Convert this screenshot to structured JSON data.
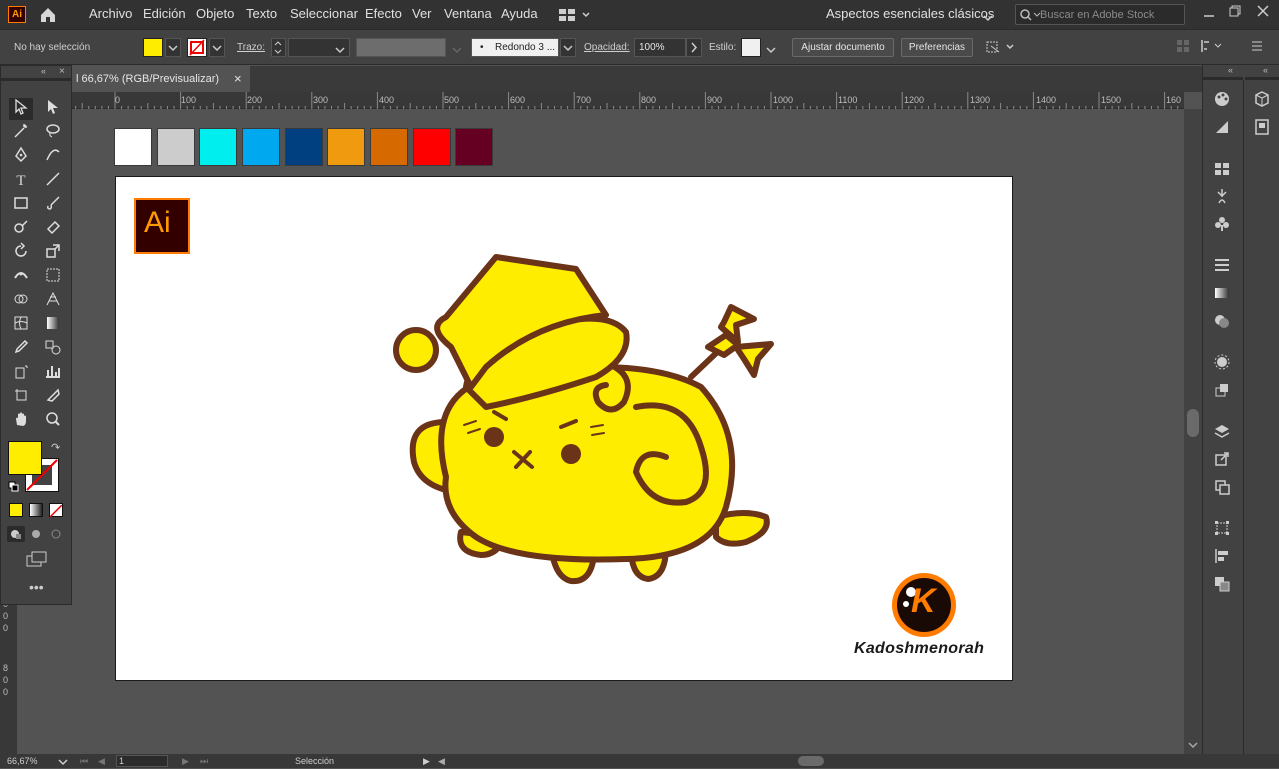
{
  "menubar": {
    "app_logo": "Ai",
    "items": [
      "Archivo",
      "Edición",
      "Objeto",
      "Texto",
      "Seleccionar",
      "Efecto",
      "Ver",
      "Ventana",
      "Ayuda"
    ],
    "workspace": "Aspectos esenciales clásicos",
    "search_placeholder": "Buscar en Adobe Stock"
  },
  "controlbar": {
    "selection": "No hay selección",
    "stroke_label": "Trazo:",
    "brush": "Redondo 3 ...",
    "opacity_label": "Opacidad:",
    "opacity_value": "100%",
    "style_label": "Estilo:",
    "fit_button": "Ajustar documento",
    "prefs_button": "Preferencias",
    "fill_color": "#ffed00"
  },
  "tab": {
    "title": "l 66,67% (RGB/Previsualizar)",
    "close": "×"
  },
  "ruler": {
    "h_labels": [
      "0",
      "100",
      "200",
      "300",
      "400",
      "500",
      "600",
      "700",
      "800",
      "900",
      "1000",
      "1100",
      "1200",
      "1300",
      "1400",
      "1500",
      "160"
    ],
    "v_labels": [
      "0",
      "0",
      "0",
      "8",
      "0",
      "0"
    ]
  },
  "swatches": [
    "#ffffff",
    "#cccccc",
    "#00eeee",
    "#00a8f0",
    "#004080",
    "#f09a10",
    "#d66a00",
    "#ff0000",
    "#660022"
  ],
  "artboard": {
    "ai_badge": "Ai",
    "logo_letter": "K",
    "signature": "Kadoshmenorah"
  },
  "status": {
    "zoom": "66,67%",
    "page": "1",
    "tool": "Selección"
  },
  "colors": {
    "character_fill": "#ffed00",
    "character_outline": "#6b3418",
    "brand_orange": "#ff7c00"
  }
}
